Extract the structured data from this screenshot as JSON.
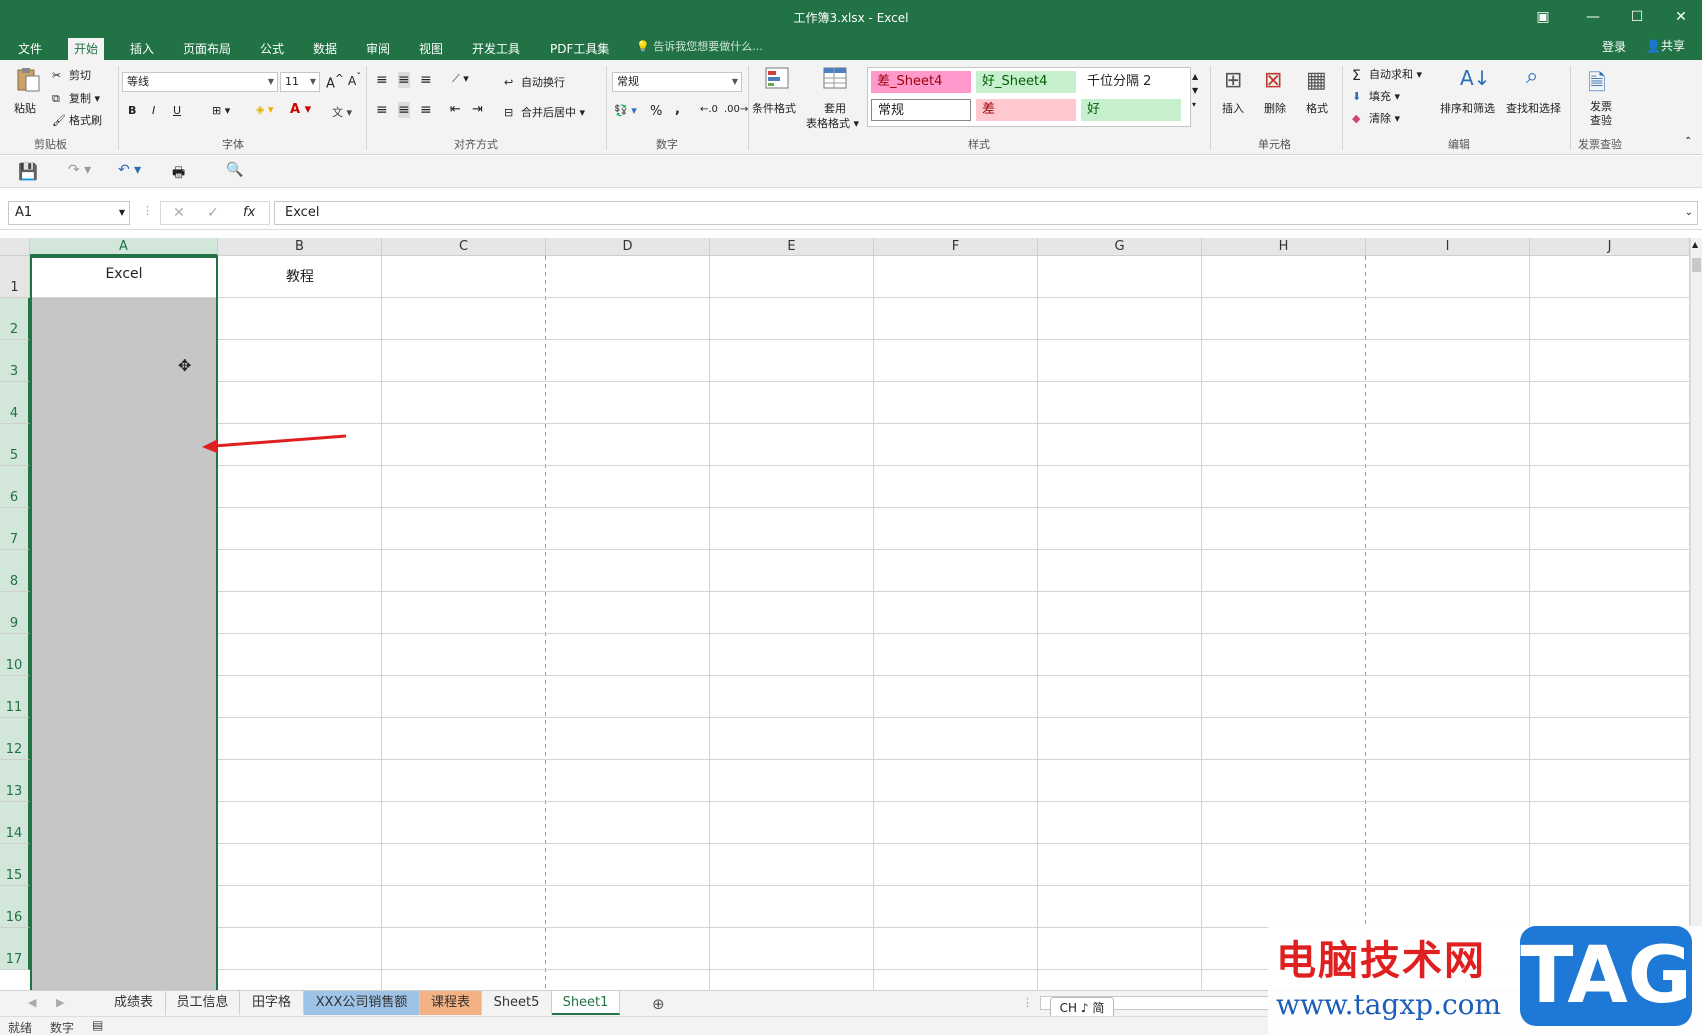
{
  "window": {
    "title": "工作簿3.xlsx - Excel"
  },
  "tabs": [
    "文件",
    "开始",
    "插入",
    "页面布局",
    "公式",
    "数据",
    "审阅",
    "视图",
    "开发工具",
    "PDF工具集"
  ],
  "tell_me": "告诉我您想要做什么...",
  "account": {
    "login": "登录",
    "share": "共享"
  },
  "ribbon": {
    "clipboard": {
      "paste": "粘贴",
      "cut": "剪切",
      "copy": "复制",
      "format_painter": "格式刷",
      "label": "剪贴板"
    },
    "font": {
      "name": "等线",
      "size": "11",
      "bold": "B",
      "italic": "I",
      "underline": "U",
      "label": "字体"
    },
    "alignment": {
      "wrap": "自动换行",
      "merge": "合并后居中",
      "label": "对齐方式"
    },
    "number": {
      "format": "常规",
      "percent": "%",
      "comma": ",",
      "label": "数字"
    },
    "styles": {
      "conditional": "条件格式",
      "table_format_1": "套用",
      "table_format_2": "表格格式",
      "cells": [
        {
          "text": "差_Sheet4",
          "bg": "#ff99cc",
          "fg": "#9c0006"
        },
        {
          "text": "好_Sheet4",
          "bg": "#c6efce",
          "fg": "#006100"
        },
        {
          "text": "千位分隔 2",
          "bg": "#ffffff",
          "fg": "#222222"
        },
        {
          "text": "常规",
          "bg": "#ffffff",
          "fg": "#222222"
        },
        {
          "text": "差",
          "bg": "#ffc7ce",
          "fg": "#9c0006"
        },
        {
          "text": "好",
          "bg": "#c6efce",
          "fg": "#006100"
        }
      ],
      "label": "样式"
    },
    "cells": {
      "insert": "插入",
      "delete": "删除",
      "format": "格式",
      "label": "单元格"
    },
    "editing": {
      "autosum": "自动求和",
      "fill": "填充",
      "clear": "清除",
      "sort": "排序和筛选",
      "find": "查找和选择",
      "label": "编辑"
    },
    "invoice": {
      "line1": "发票",
      "line2": "查验",
      "label": "发票查验"
    }
  },
  "formula_bar": {
    "name_box": "A1",
    "fx": "fx",
    "value": "Excel"
  },
  "columns": [
    "A",
    "B",
    "C",
    "D",
    "E",
    "F",
    "G",
    "H",
    "I",
    "J"
  ],
  "rows": [
    "1",
    "2",
    "3",
    "4",
    "5",
    "6",
    "7",
    "8",
    "9",
    "10",
    "11",
    "12",
    "13",
    "14",
    "15",
    "16",
    "17"
  ],
  "cells": {
    "A1": "Excel",
    "B1": "教程"
  },
  "sheets": [
    {
      "name": "成绩表",
      "color": ""
    },
    {
      "name": "员工信息",
      "color": ""
    },
    {
      "name": "田字格",
      "color": ""
    },
    {
      "name": "XXX公司销售额",
      "color": "#9dc3e6"
    },
    {
      "name": "课程表",
      "color": "#f4b183"
    },
    {
      "name": "Sheet5",
      "color": ""
    },
    {
      "name": "Sheet1",
      "color": ""
    }
  ],
  "status": {
    "ready": "就绪",
    "mode": "数字",
    "ime": "CH ♪ 简"
  },
  "watermark": {
    "text": "电脑技术网",
    "url": "www.tagxp.com",
    "tag": "TAG"
  }
}
